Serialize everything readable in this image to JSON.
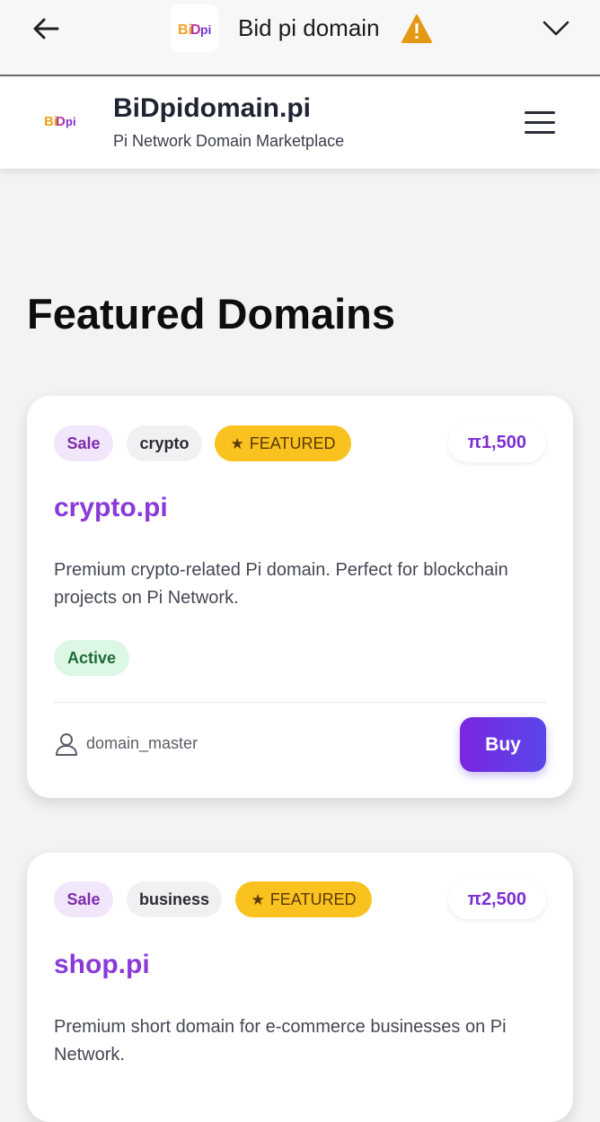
{
  "browser": {
    "tab_title": "Bid pi domain"
  },
  "header": {
    "title": "BiDpidomain.pi",
    "subtitle": "Pi Network Domain Marketplace"
  },
  "section": {
    "title": "Featured Domains"
  },
  "cards": [
    {
      "listing_type": "Sale",
      "category": "crypto",
      "featured_label": "FEATURED",
      "price": "π1,500",
      "domain": "crypto.pi",
      "description": "Premium crypto-related Pi domain. Perfect for blockchain projects on Pi Network.",
      "status": "Active",
      "seller": "domain_master",
      "action_label": "Buy"
    },
    {
      "listing_type": "Sale",
      "category": "business",
      "featured_label": "FEATURED",
      "price": "π2,500",
      "domain": "shop.pi",
      "description": "Premium short domain for e-commerce businesses on Pi Network."
    }
  ],
  "colors": {
    "accent": "#8a3ad8",
    "featured": "#f9c21e",
    "status_active_bg": "#dcf7e3",
    "button_gradient_start": "#7a26e0",
    "button_gradient_end": "#5a47e8"
  }
}
